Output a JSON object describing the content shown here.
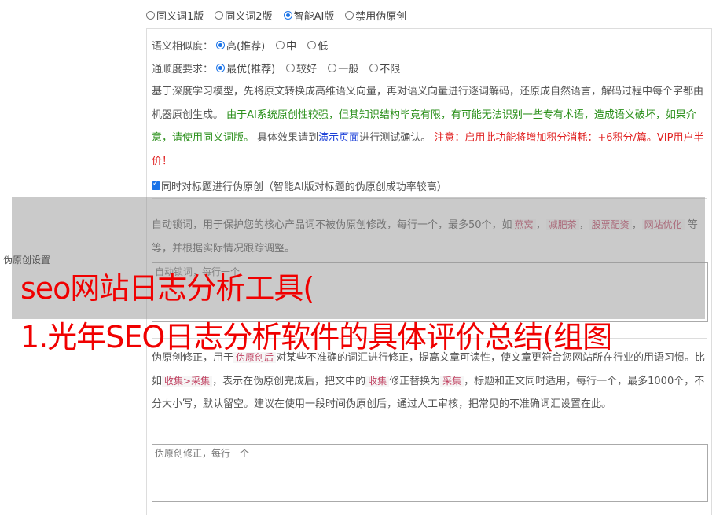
{
  "mode_options": [
    "同义词1版",
    "同义词2版",
    "智能AI版",
    "禁用伪原创"
  ],
  "mode_selected": "智能AI版",
  "similarity": {
    "label": "语义相似度：",
    "options": [
      "高(推荐)",
      "中",
      "低"
    ],
    "selected": "高(推荐)"
  },
  "fluency": {
    "label": "通顺度要求：",
    "options": [
      "最优(推荐)",
      "较好",
      "一般",
      "不限"
    ],
    "selected": "最优(推荐)"
  },
  "description": {
    "intro": "基于深度学习模型，先将原文转换成高维语义向量，再对语义向量进行逐词解码，还原成自然语言，解码过程中每个字都由机器原创生成。",
    "warning_green": "由于AI系统原创性较强，但其知识结构毕竟有限，有可能无法识别一些专有术语，造成语义破坏，如果介意，请使用同义词版。",
    "test_prefix": "具体效果请到",
    "test_link": "演示页面",
    "test_suffix": "进行测试确认。",
    "notice_red": "注意：启用此功能将增加积分消耗：+6积分/篇。VIP用户半价！"
  },
  "title_checkbox": {
    "label": "同时对标题进行伪原创（智能AI版对标题的伪原创成功率较高）",
    "checked": true
  },
  "lock_words": {
    "desc_prefix": "自动锁词，用于保护您的核心产品词不被伪原创修改，每行一个，最多50个，如",
    "examples": [
      "燕窝",
      "减肥茶",
      "股票配资",
      "网站优化"
    ],
    "desc_suffix": "等等，并根据实际情况跟踪调整。",
    "placeholder": "自动锁词，每行一个"
  },
  "side_label": "伪原创设置",
  "headline": {
    "line1": "seo网站日志分析工具(",
    "line2": "1.光年SEO日志分析软件的具体评价总结(组图"
  },
  "correction": {
    "desc_a": "伪原创修正，用于",
    "tag_a": "伪原创后",
    "desc_b": "对某些不准确的词汇进行修正，提高文章可读性，使文章更符合您网站所在行业的用语习惯。比如",
    "tag_b": "收集>采集",
    "desc_c": "，表示在伪原创完成后，把文中的",
    "tag_c": "收集",
    "desc_d": "修正替换为",
    "tag_d": "采集",
    "desc_e": "，标题和正文同时适用，每行一个，最多1000个，不分大小写，默认留空。建议在使用一段时间伪原创后，通过人工审核，把常见的不准确词汇设置在此。",
    "placeholder": "伪原创修正，每行一个"
  },
  "colors": {
    "accent": "#1a73e8",
    "green": "#2a8f1a",
    "red": "#e02020",
    "headline": "#f00000"
  }
}
